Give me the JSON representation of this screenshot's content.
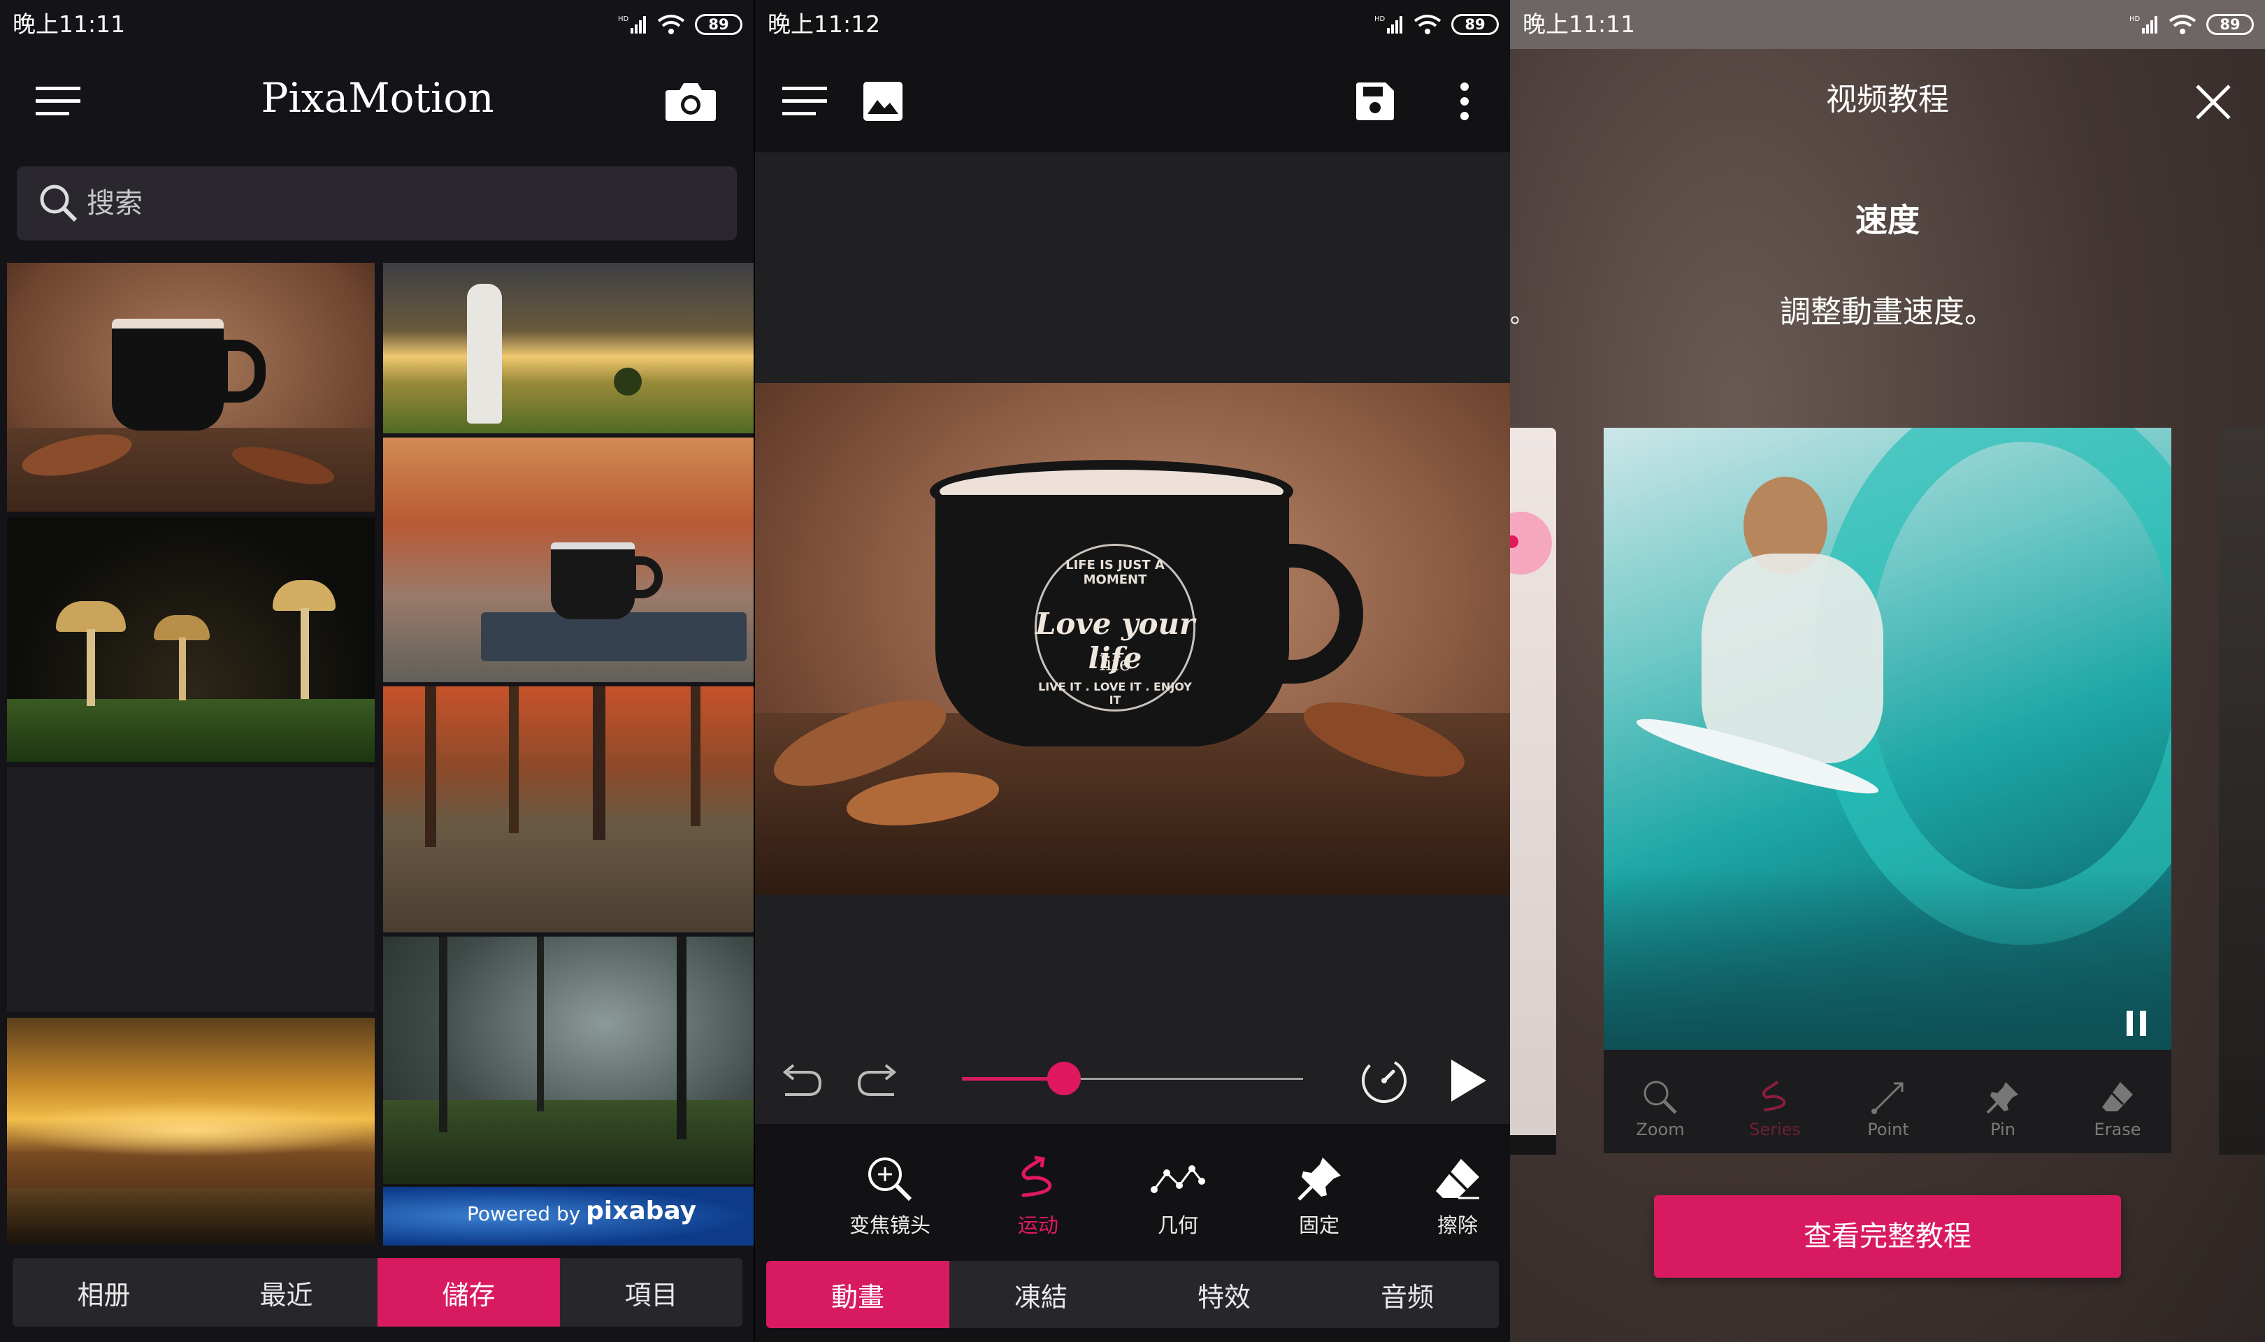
{
  "screen1": {
    "status": {
      "time": "晚上11:11",
      "battery": "89"
    },
    "app_title": "PixaMotion",
    "search": {
      "placeholder": "搜索"
    },
    "tabs": [
      {
        "label": "相册"
      },
      {
        "label": "最近"
      },
      {
        "label": "儲存",
        "active": true
      },
      {
        "label": "項目"
      }
    ],
    "attribution": {
      "prefix": "Powered by",
      "brand": "pixabay"
    },
    "icons": [
      "menu-icon",
      "camera-icon",
      "search-icon"
    ]
  },
  "screen2": {
    "status": {
      "time": "晚上11:12",
      "battery": "89"
    },
    "mug_text": {
      "arc_top": "LIFE IS JUST A MOMENT",
      "script": "Love your life",
      "center": "life",
      "arc_bottom": "LIVE IT . LOVE IT . ENJOY IT"
    },
    "speed_slider": {
      "value": 0.3
    },
    "tools": [
      {
        "label": "变焦镜头",
        "icon": "zoom-icon"
      },
      {
        "label": "运动",
        "icon": "motion-icon",
        "active": true
      },
      {
        "label": "几何",
        "icon": "geometry-icon"
      },
      {
        "label": "固定",
        "icon": "pin-icon"
      },
      {
        "label": "擦除",
        "icon": "eraser-icon"
      }
    ],
    "tabs": [
      {
        "label": "動畫",
        "active": true
      },
      {
        "label": "凍結"
      },
      {
        "label": "特效"
      },
      {
        "label": "音频"
      }
    ],
    "icons": [
      "menu-icon",
      "image-icon",
      "save-icon",
      "more-icon",
      "undo-icon",
      "redo-icon",
      "speed-icon",
      "play-icon"
    ]
  },
  "screen3": {
    "status": {
      "time": "晚上11:11",
      "battery": "89"
    },
    "title": "视频教程",
    "heading": "速度",
    "description": "調整動畫速度。",
    "stray_mark": "。",
    "video_tools": [
      {
        "label": "Zoom"
      },
      {
        "label": "Series",
        "active": true
      },
      {
        "label": "Point"
      },
      {
        "label": "Pin"
      },
      {
        "label": "Erase"
      }
    ],
    "cta_button": "查看完整教程",
    "icons": [
      "close-icon",
      "pause-icon"
    ]
  },
  "colors": {
    "accent": "#d81b60",
    "background": "#141317",
    "tab_bar": "#27262b"
  }
}
